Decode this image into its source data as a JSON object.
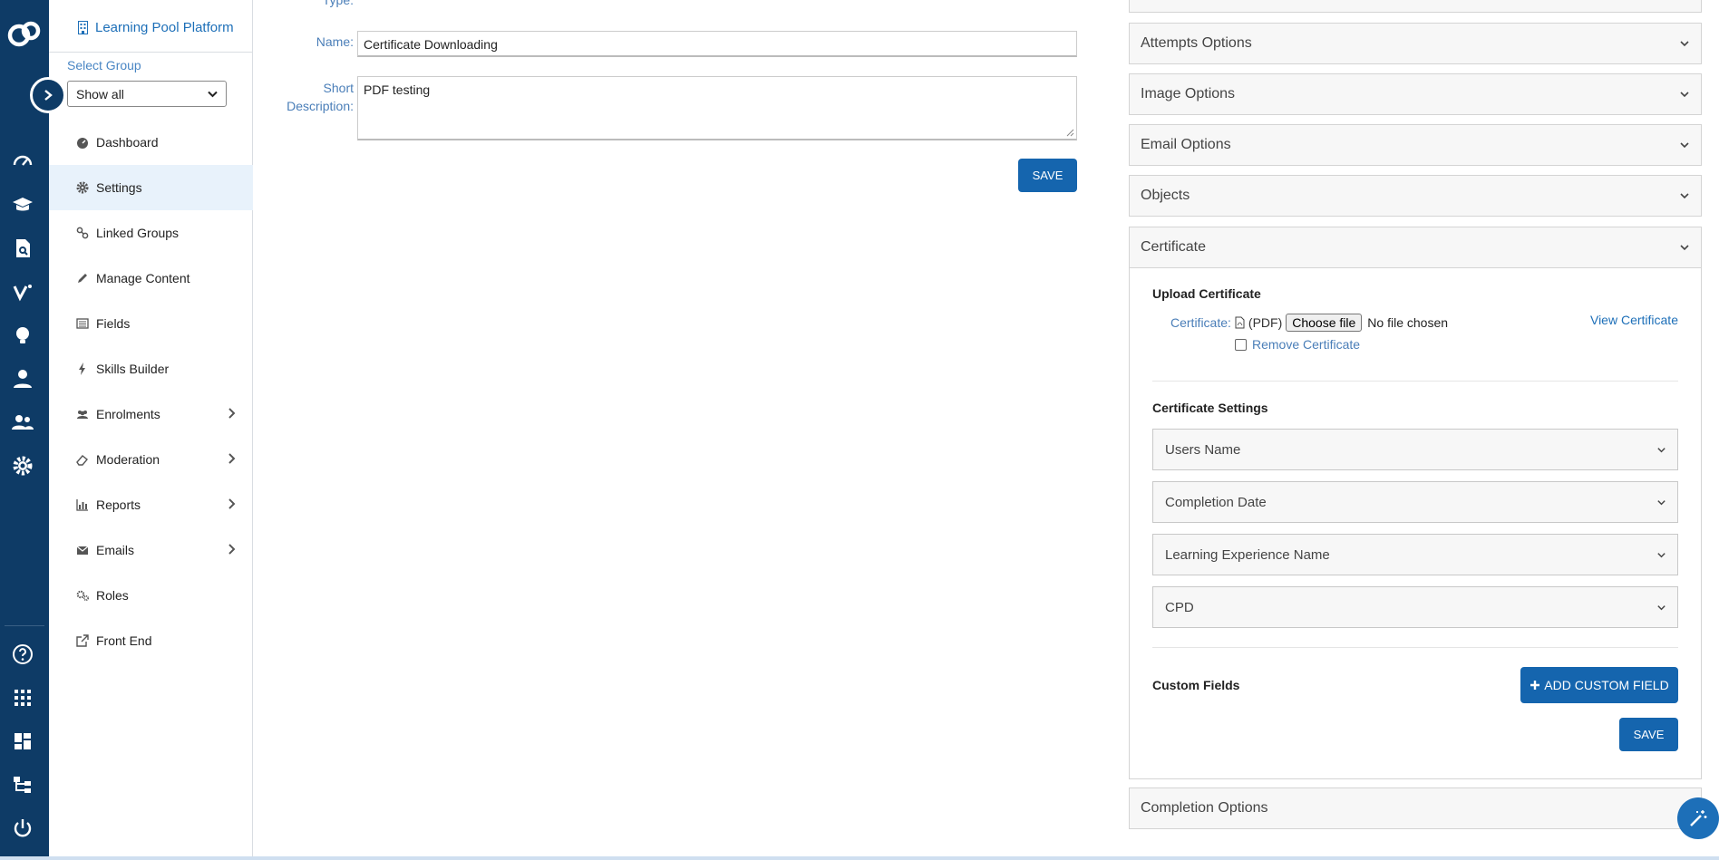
{
  "brand": {
    "name": "Learning Pool Platform"
  },
  "group": {
    "label": "Select Group",
    "value": "Show all"
  },
  "nav": [
    {
      "label": "Dashboard",
      "icon": "dashboard-icon"
    },
    {
      "label": "Settings",
      "icon": "gear-icon",
      "active": true
    },
    {
      "label": "Linked Groups",
      "icon": "link-icon"
    },
    {
      "label": "Manage Content",
      "icon": "pencil-icon"
    },
    {
      "label": "Fields",
      "icon": "fields-icon"
    },
    {
      "label": "Skills Builder",
      "icon": "bolt-icon"
    },
    {
      "label": "Enrolments",
      "icon": "users-icon",
      "submenu": true
    },
    {
      "label": "Moderation",
      "icon": "eraser-icon",
      "submenu": true
    },
    {
      "label": "Reports",
      "icon": "bar-chart-icon",
      "submenu": true
    },
    {
      "label": "Emails",
      "icon": "envelope-icon",
      "submenu": true
    },
    {
      "label": "Roles",
      "icon": "gears-icon"
    },
    {
      "label": "Front End",
      "icon": "external-link-icon"
    }
  ],
  "form": {
    "type_label": "Type:",
    "name_label": "Name:",
    "name_value": "Certificate Downloading",
    "short_desc_label_1": "Short",
    "short_desc_label_2": "Description:",
    "short_desc_value": "PDF testing",
    "save_label": "SAVE"
  },
  "accordions": {
    "attempts": "Attempts Options",
    "image": "Image Options",
    "email": "Email Options",
    "objects": "Objects",
    "certificate": "Certificate",
    "completion": "Completion Options"
  },
  "certificate": {
    "upload_heading": "Upload Certificate",
    "cert_label": "Certificate:",
    "pdf_label": "(PDF)",
    "choose_file": "Choose file",
    "no_file": "No file chosen",
    "view_link": "View Certificate",
    "remove_label": "Remove Certificate",
    "settings_heading": "Certificate Settings",
    "settings": [
      "Users Name",
      "Completion Date",
      "Learning Experience Name",
      "CPD"
    ],
    "custom_heading": "Custom Fields",
    "add_custom": "ADD CUSTOM FIELD",
    "save_label": "SAVE"
  },
  "colors": {
    "rail": "#0e3b66",
    "primary": "#1565ae",
    "link": "#1d6fb8"
  }
}
